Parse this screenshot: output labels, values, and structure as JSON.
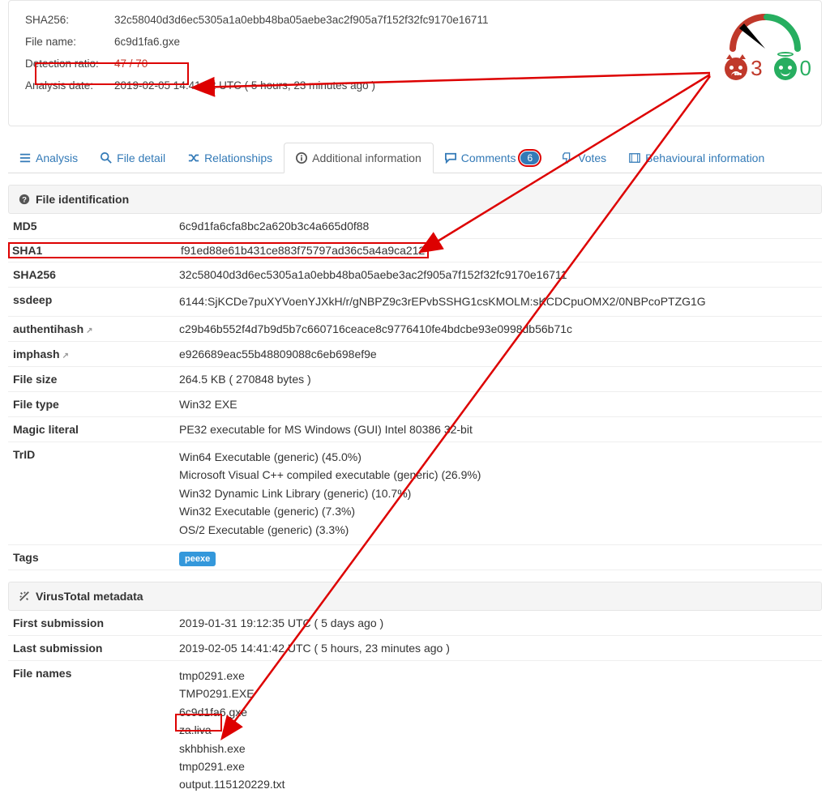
{
  "header": {
    "rows": [
      {
        "label": "SHA256:",
        "value": "32c58040d3d6ec5305a1a0ebb48ba05aebe3ac2f905a7f152f32fc9170e16711"
      },
      {
        "label": "File name:",
        "value": "6c9d1fa6.gxe"
      },
      {
        "label": "Detection ratio:",
        "value": "47 / 70",
        "highlight": true
      },
      {
        "label": "Analysis date:",
        "value": "2019-02-05 14:41:42 UTC ( 5 hours, 23 minutes ago )"
      }
    ],
    "votes": {
      "malicious": "3",
      "harmless": "0"
    }
  },
  "tabs": {
    "analysis": "Analysis",
    "file_detail": "File detail",
    "relationships": "Relationships",
    "additional": "Additional information",
    "comments": "Comments",
    "comments_count": "6",
    "votes": "Votes",
    "behavioural": "Behavioural information"
  },
  "panels": {
    "file_id_title": "File identification",
    "vt_meta_title": "VirusTotal metadata"
  },
  "file_id": {
    "md5": {
      "k": "MD5",
      "v": "6c9d1fa6cfa8bc2a620b3c4a665d0f88"
    },
    "sha1": {
      "k": "SHA1",
      "v": "f91ed88e61b431ce883f75797ad36c5a4a9ca212"
    },
    "sha256": {
      "k": "SHA256",
      "v": "32c58040d3d6ec5305a1a0ebb48ba05aebe3ac2f905a7f152f32fc9170e16711"
    },
    "ssdeep": {
      "k": "ssdeep",
      "v": "6144:SjKCDe7puXYVoenYJXkH/r/gNBPZ9c3rEPvbSSHG1csKMOLM:sKCDCpuOMX2/0NBPcoPTZG1G"
    },
    "authentihash": {
      "k": "authentihash",
      "v": "c29b46b552f4d7b9d5b7c660716ceace8c9776410fe4bdcbe93e0998db56b71c"
    },
    "imphash": {
      "k": "imphash",
      "v": "e926689eac55b48809088c6eb698ef9e"
    },
    "filesize": {
      "k": "File size",
      "v": "264.5 KB ( 270848 bytes )"
    },
    "filetype": {
      "k": "File type",
      "v": "Win32 EXE"
    },
    "magic": {
      "k": "Magic literal",
      "v": "PE32 executable for MS Windows (GUI) Intel 80386 32-bit"
    },
    "trid": {
      "k": "TrID",
      "lines": [
        "Win64 Executable (generic) (45.0%)",
        "Microsoft Visual C++ compiled executable (generic) (26.9%)",
        "Win32 Dynamic Link Library (generic) (10.7%)",
        "Win32 Executable (generic) (7.3%)",
        "OS/2 Executable (generic) (3.3%)"
      ]
    },
    "tags": {
      "k": "Tags",
      "tag": "peexe"
    }
  },
  "vt_meta": {
    "first": {
      "k": "First submission",
      "v": "2019-01-31 19:12:35 UTC ( 5 days ago )"
    },
    "last": {
      "k": "Last submission",
      "v": "2019-02-05 14:41:42 UTC ( 5 hours, 23 minutes ago )"
    },
    "filenames": {
      "k": "File names",
      "lines": [
        "tmp0291.exe",
        "TMP0291.EXE",
        "6c9d1fa6.gxe",
        "za.liva",
        "skhbhish.exe",
        "tmp0291.exe",
        "output.115120229.txt"
      ]
    }
  }
}
